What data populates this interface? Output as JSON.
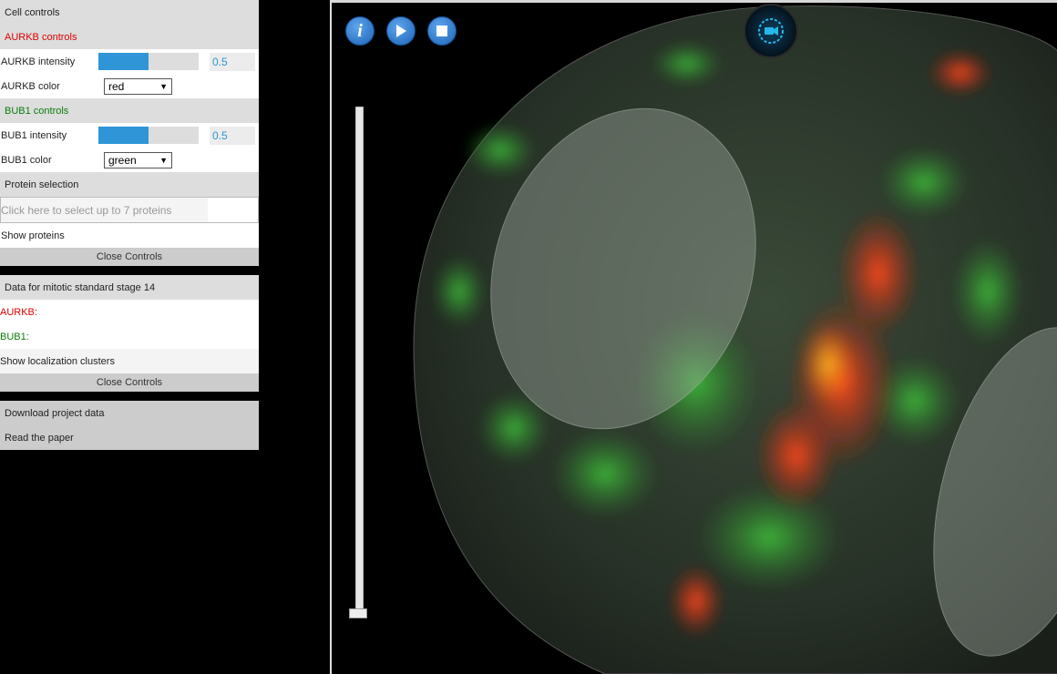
{
  "cell_controls": {
    "title": "Cell controls",
    "aurkb": {
      "header": "AURKB controls",
      "intensity_label": "AURKB intensity",
      "intensity_value": "0.5",
      "intensity_fraction": 0.5,
      "color_label": "AURKB color",
      "color_value": "red"
    },
    "bub1": {
      "header": "BUB1 controls",
      "intensity_label": "BUB1 intensity",
      "intensity_value": "0.5",
      "intensity_fraction": 0.5,
      "color_label": "BUB1 color",
      "color_value": "green"
    },
    "protein_selection": {
      "header": "Protein selection",
      "placeholder": "Click here to select up to 7 proteins",
      "show_proteins": "Show proteins"
    },
    "close": "Close Controls"
  },
  "data_panel": {
    "title": "Data for mitotic standard stage 14",
    "aurkb_label": "AURKB:",
    "bub1_label": "BUB1:",
    "show_clusters": "Show localization clusters",
    "close": "Close Controls"
  },
  "links": {
    "download": "Download project data",
    "paper": "Read the paper"
  },
  "viewer": {
    "buttons": [
      "info-icon",
      "play-icon",
      "stop-icon",
      "camera-icon"
    ],
    "colors": {
      "aurkb": "#e00000",
      "bub1": "#0a7d0a",
      "accent": "#2f95d6"
    }
  }
}
